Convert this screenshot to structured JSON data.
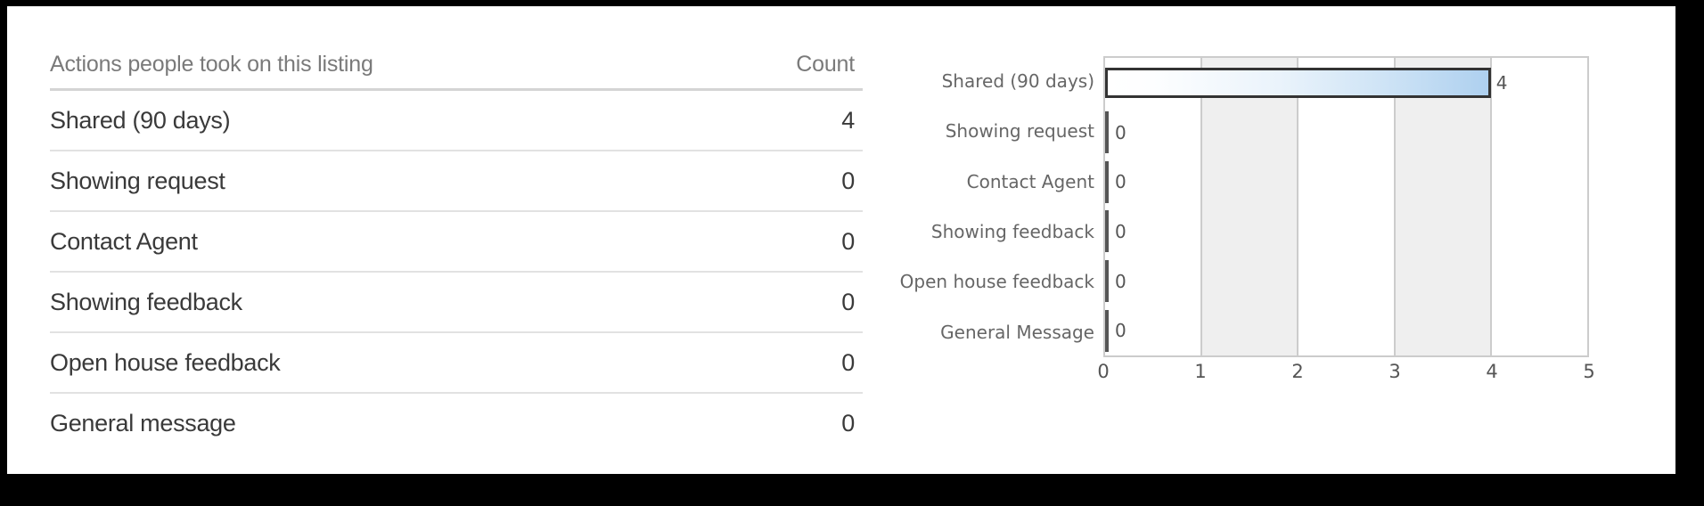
{
  "table": {
    "header": {
      "action_column": "Actions people took on this listing",
      "count_column": "Count"
    },
    "rows": [
      {
        "action": "Shared (90 days)",
        "count": "4"
      },
      {
        "action": "Showing request",
        "count": "0"
      },
      {
        "action": "Contact Agent",
        "count": "0"
      },
      {
        "action": "Showing feedback",
        "count": "0"
      },
      {
        "action": "Open house feedback",
        "count": "0"
      },
      {
        "action": "General message",
        "count": "0"
      }
    ]
  },
  "chart_data": {
    "type": "bar",
    "orientation": "horizontal",
    "title": "",
    "xlabel": "",
    "ylabel": "",
    "categories": [
      "Shared (90 days)",
      "Showing request",
      "Contact Agent",
      "Showing feedback",
      "Open house feedback",
      "General Message"
    ],
    "values": [
      4,
      0,
      0,
      0,
      0,
      0
    ],
    "data_labels": [
      "4",
      "0",
      "0",
      "0",
      "0",
      "0"
    ],
    "xlim": [
      0,
      5
    ],
    "xticks": [
      "0",
      "1",
      "2",
      "3",
      "4",
      "5"
    ],
    "grid": true,
    "legend": false,
    "colors": {
      "bar_gradient_start": "#ffffff",
      "bar_gradient_end": "#aed0ef",
      "bar_border": "#333333",
      "band_shade": "#efefef",
      "band_plain": "#ffffff",
      "plot_border": "#cccccc",
      "label_text": "#666666"
    }
  }
}
